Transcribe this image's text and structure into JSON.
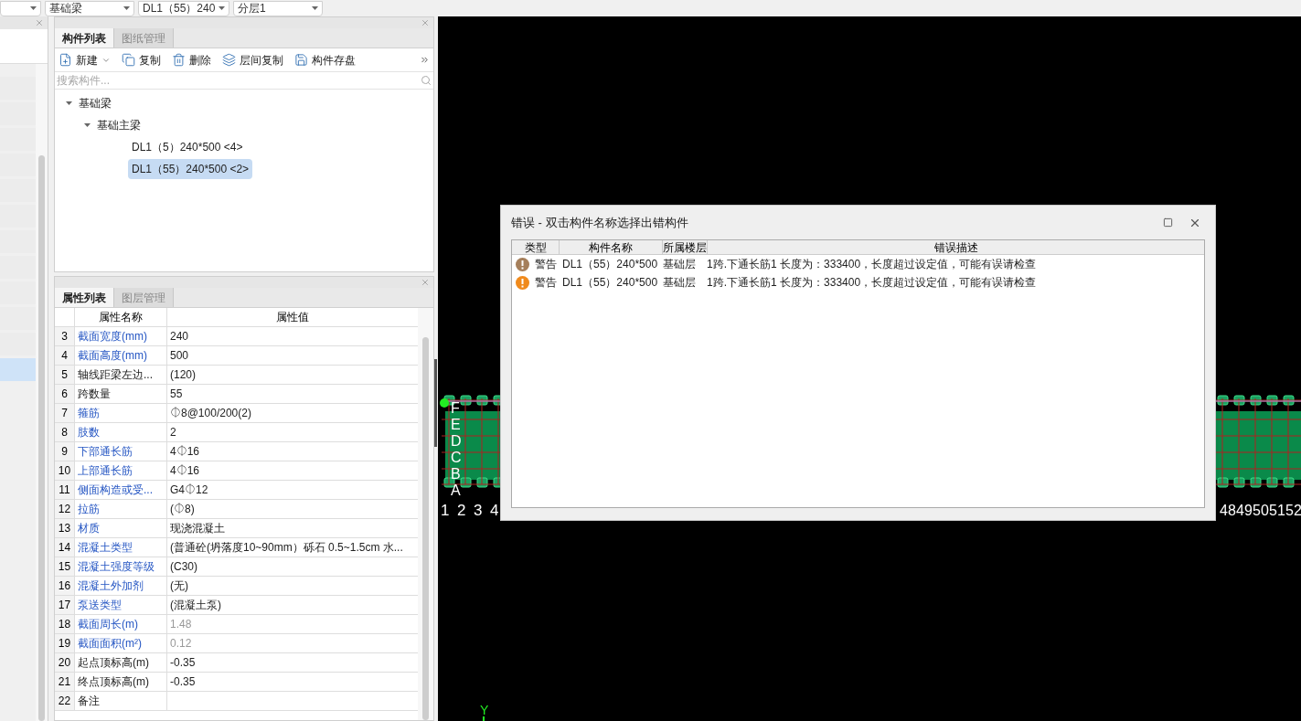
{
  "toolbar": {
    "dropdowns": [
      {
        "kind": "blank"
      },
      {
        "kind": "text",
        "value": "基础梁"
      },
      {
        "kind": "text",
        "value": "DL1（55）240"
      },
      {
        "kind": "text",
        "value": "分层1"
      }
    ]
  },
  "left_panel": {
    "items": [
      {
        "selected": false
      },
      {
        "selected": false
      },
      {
        "selected": false
      },
      {
        "selected": false
      },
      {
        "selected": false
      },
      {
        "selected": false
      },
      {
        "selected": false
      },
      {
        "selected": false
      },
      {
        "selected": false
      },
      {
        "selected": false
      },
      {
        "selected": false
      },
      {
        "selected": true
      }
    ]
  },
  "component_panel": {
    "tabs": [
      {
        "label": "构件列表",
        "selected": true
      },
      {
        "label": "图纸管理",
        "selected": false
      }
    ],
    "actions": [
      {
        "kind": "new",
        "label": "新建"
      },
      {
        "kind": "copy",
        "label": "复制"
      },
      {
        "kind": "delete",
        "label": "删除"
      },
      {
        "kind": "layer-copy",
        "label": "层间复制"
      },
      {
        "kind": "save",
        "label": "构件存盘"
      }
    ],
    "search": {
      "placeholder": "搜索构件..."
    },
    "tree": [
      {
        "label": "基础梁",
        "expanded": true,
        "selected": false,
        "children": [
          {
            "label": "基础主梁",
            "expanded": true,
            "selected": false,
            "children": [
              {
                "label": "DL1（5）240*500 <4>",
                "selected": false
              },
              {
                "label": "DL1（55）240*500 <2>",
                "selected": true
              }
            ]
          }
        ]
      }
    ]
  },
  "property_panel": {
    "tabs": [
      {
        "label": "属性列表",
        "selected": true
      },
      {
        "label": "图层管理",
        "selected": false
      }
    ],
    "columns": [
      "属性名称",
      "属性值"
    ],
    "rows": [
      {
        "num": "3",
        "name": "截面宽度(mm)",
        "value": "240",
        "linked": true,
        "readonly": false
      },
      {
        "num": "4",
        "name": "截面高度(mm)",
        "value": "500",
        "linked": true,
        "readonly": false
      },
      {
        "num": "5",
        "name": "轴线距梁左边...",
        "value": "(120)",
        "linked": false,
        "readonly": false
      },
      {
        "num": "6",
        "name": "跨数量",
        "value": "55",
        "linked": false,
        "readonly": false
      },
      {
        "num": "7",
        "name": "箍筋",
        "value": "⏀8@100/200(2)",
        "linked": true,
        "readonly": false
      },
      {
        "num": "8",
        "name": "肢数",
        "value": "2",
        "linked": true,
        "readonly": false
      },
      {
        "num": "9",
        "name": "下部通长筋",
        "value": "4⏀16",
        "linked": true,
        "readonly": false
      },
      {
        "num": "10",
        "name": "上部通长筋",
        "value": "4⏀16",
        "linked": true,
        "readonly": false
      },
      {
        "num": "11",
        "name": "侧面构造或受...",
        "value": "G4⏀12",
        "linked": true,
        "readonly": false
      },
      {
        "num": "12",
        "name": "拉筋",
        "value": "(⏀8)",
        "linked": true,
        "readonly": false
      },
      {
        "num": "13",
        "name": "材质",
        "value": "现浇混凝土",
        "linked": true,
        "readonly": false
      },
      {
        "num": "14",
        "name": "混凝土类型",
        "value": "(普通砼(坍落度10~90mm）砾石 0.5~1.5cm 水...",
        "linked": true,
        "readonly": false
      },
      {
        "num": "15",
        "name": "混凝土强度等级",
        "value": "(C30)",
        "linked": true,
        "readonly": false
      },
      {
        "num": "16",
        "name": "混凝土外加剂",
        "value": "(无)",
        "linked": true,
        "readonly": false
      },
      {
        "num": "17",
        "name": "泵送类型",
        "value": "(混凝土泵)",
        "linked": true,
        "readonly": false
      },
      {
        "num": "18",
        "name": "截面周长(m)",
        "value": "1.48",
        "linked": true,
        "readonly": true
      },
      {
        "num": "19",
        "name": "截面面积(m²)",
        "value": "0.12",
        "linked": true,
        "readonly": true
      },
      {
        "num": "20",
        "name": "起点顶标高(m)",
        "value": "-0.35",
        "linked": false,
        "readonly": false
      },
      {
        "num": "21",
        "name": "终点顶标高(m)",
        "value": "-0.35",
        "linked": false,
        "readonly": false
      },
      {
        "num": "22",
        "name": "备注",
        "linked": false
      }
    ]
  },
  "canvas": {
    "row_labels": [
      "F",
      "E",
      "D",
      "C",
      "B",
      "A"
    ],
    "left_col_labels": [
      "1",
      "2",
      "3",
      "4"
    ],
    "right_col_labels": [
      "48",
      "49",
      "50",
      "51",
      "52"
    ],
    "axis_label": "Y"
  },
  "dialog": {
    "title": "错误 - 双击构件名称选择出错构件",
    "columns": [
      "类型",
      "构件名称",
      "所属楼层",
      "错误描述"
    ],
    "rows": [
      {
        "color": "#a57f5b",
        "type": "警告",
        "name": "DL1（55）240*500",
        "floor": "基础层",
        "description": "1跨.下通长筋1 长度为：333400，长度超过设定值，可能有误请检查"
      },
      {
        "color": "#f08a1c",
        "type": "警告",
        "name": "DL1（55）240*500",
        "floor": "基础层",
        "description": "1跨.下通长筋1 长度为：333400，长度超过设定值，可能有误请检查"
      }
    ]
  }
}
